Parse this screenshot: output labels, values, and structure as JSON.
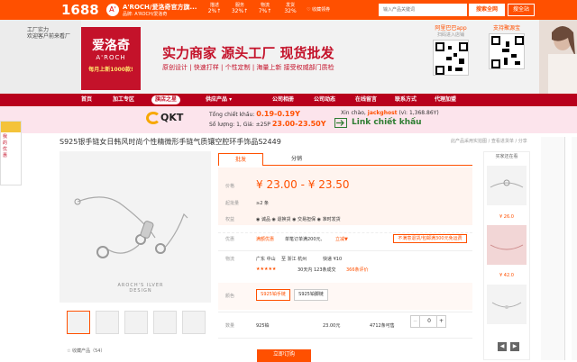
{
  "topbar": {
    "logo": "1688",
    "shop_badge": "A'",
    "shop_name": "A'ROCH/爱洛奇官方旗...",
    "shop_sub": "品牌: A'ROCH/爱洛奇",
    "stats": [
      {
        "label": "描述",
        "value": "2%↑"
      },
      {
        "label": "服务",
        "value": "32%↑"
      },
      {
        "label": "物流",
        "value": "7%↑"
      },
      {
        "label": "发货",
        "value": "32%"
      }
    ],
    "favorite": "收藏领券",
    "search_placeholder": "输入产品关键词",
    "search_all_label": "搜索全网",
    "search_shop_label": "搜全站"
  },
  "banner": {
    "left_text_1": "工厂实力",
    "left_text_2": "欢迎客户前来看厂",
    "brand_cn": "爱洛奇",
    "brand_en": "A'ROCH",
    "brand_tag": "每月上新1000款!",
    "slogan": "实力商家  源头工厂  现货批发",
    "slogan_sub": "原创设计 | 快速打样 | 个性定制 | 海量上新      接受权威部门质检",
    "qr_app_label": "阿里巴巴app",
    "qr_app_sub": "扫码进入店铺",
    "qr_shop_label": "支持聚源宝"
  },
  "nav": {
    "items": [
      "首页",
      "加工专区",
      "旗店之星",
      "供应产品 ▾",
      "公司相册",
      "公司动态",
      "在线留言",
      "联系方式",
      "代理加盟"
    ]
  },
  "promo": {
    "brand": "QKT",
    "price_line_1_label": "Tổng chiết khấu: ",
    "price_line_1_value": "0.19-0.19Y",
    "price_line_2_label": "Số lượng: 1, Giá: ±25P ",
    "price_line_2_value": "23.00-23.50Y",
    "greeting_prefix": "Xin chào, ",
    "greeting_user": "jackghost",
    "greeting_suffix": " (vì: 1,368.86Y)",
    "link_label": "Link chiết khấu"
  },
  "side_widget": {
    "lines": [
      "我",
      "的",
      "优",
      "惠"
    ]
  },
  "product": {
    "title": "S925银手链女日韩风时尚个性精微形手链气质镶空腔环手饰品S2449",
    "small_note": "此产品采用实拍图 / 查看进货单 / 分享",
    "image_brand": "AROCH'S ILVER",
    "image_brand_sub": "DESIGN",
    "collect": "收藏产品（54）"
  },
  "tabs": [
    "批发",
    "分销"
  ],
  "price": {
    "label": "价格",
    "value": "¥ 23.00  -  ¥ 23.50",
    "moq_label": "起批量",
    "moq_value": "≥2 条",
    "service_label": "权益",
    "service_value": "◉ 诚品  ◉ 退换货  ◉ 交易担保  ◉ 准时发货"
  },
  "deal": {
    "label": "优惠",
    "tag": "满额优惠",
    "desc": "单笔订单满200元,",
    "link": "立减▼",
    "coupon": "不满意退货/包邮满300元免运费"
  },
  "logistics": {
    "label": "物流",
    "from": "广东 中山",
    "to": "至 浙江 杭州",
    "fee": "快递 ¥10",
    "stars": "★★★★★",
    "rating": "30天内 123条成交",
    "sold": "366条评价"
  },
  "color": {
    "label": "颜色",
    "options": [
      "S925铂手链",
      "S925铂脚链"
    ]
  },
  "quantity": {
    "label": "数量",
    "sku": "925铂",
    "price": "23.00元",
    "stock": "4712条可售",
    "minus": "−",
    "value": "0",
    "plus": "+"
  },
  "buy_button": "立即订购",
  "right_sidebar": {
    "title": "买家还在看",
    "prices": [
      "¥ 26.0",
      "¥ 42.0"
    ]
  },
  "nav_arrows": [
    "◀",
    "▶"
  ]
}
